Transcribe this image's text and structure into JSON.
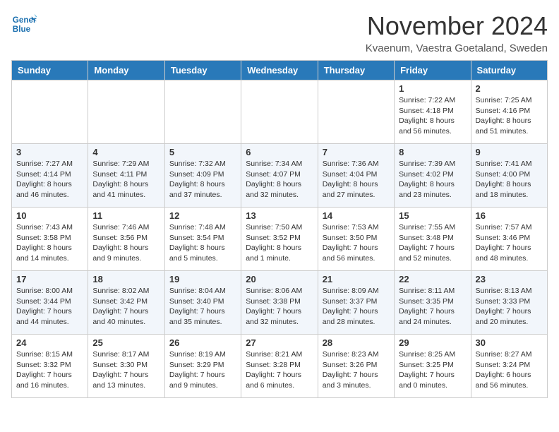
{
  "header": {
    "logo_line1": "General",
    "logo_line2": "Blue",
    "month_title": "November 2024",
    "location": "Kvaenum, Vaestra Goetaland, Sweden"
  },
  "weekdays": [
    "Sunday",
    "Monday",
    "Tuesday",
    "Wednesday",
    "Thursday",
    "Friday",
    "Saturday"
  ],
  "weeks": [
    [
      {
        "day": "",
        "info": ""
      },
      {
        "day": "",
        "info": ""
      },
      {
        "day": "",
        "info": ""
      },
      {
        "day": "",
        "info": ""
      },
      {
        "day": "",
        "info": ""
      },
      {
        "day": "1",
        "info": "Sunrise: 7:22 AM\nSunset: 4:18 PM\nDaylight: 8 hours\nand 56 minutes."
      },
      {
        "day": "2",
        "info": "Sunrise: 7:25 AM\nSunset: 4:16 PM\nDaylight: 8 hours\nand 51 minutes."
      }
    ],
    [
      {
        "day": "3",
        "info": "Sunrise: 7:27 AM\nSunset: 4:14 PM\nDaylight: 8 hours\nand 46 minutes."
      },
      {
        "day": "4",
        "info": "Sunrise: 7:29 AM\nSunset: 4:11 PM\nDaylight: 8 hours\nand 41 minutes."
      },
      {
        "day": "5",
        "info": "Sunrise: 7:32 AM\nSunset: 4:09 PM\nDaylight: 8 hours\nand 37 minutes."
      },
      {
        "day": "6",
        "info": "Sunrise: 7:34 AM\nSunset: 4:07 PM\nDaylight: 8 hours\nand 32 minutes."
      },
      {
        "day": "7",
        "info": "Sunrise: 7:36 AM\nSunset: 4:04 PM\nDaylight: 8 hours\nand 27 minutes."
      },
      {
        "day": "8",
        "info": "Sunrise: 7:39 AM\nSunset: 4:02 PM\nDaylight: 8 hours\nand 23 minutes."
      },
      {
        "day": "9",
        "info": "Sunrise: 7:41 AM\nSunset: 4:00 PM\nDaylight: 8 hours\nand 18 minutes."
      }
    ],
    [
      {
        "day": "10",
        "info": "Sunrise: 7:43 AM\nSunset: 3:58 PM\nDaylight: 8 hours\nand 14 minutes."
      },
      {
        "day": "11",
        "info": "Sunrise: 7:46 AM\nSunset: 3:56 PM\nDaylight: 8 hours\nand 9 minutes."
      },
      {
        "day": "12",
        "info": "Sunrise: 7:48 AM\nSunset: 3:54 PM\nDaylight: 8 hours\nand 5 minutes."
      },
      {
        "day": "13",
        "info": "Sunrise: 7:50 AM\nSunset: 3:52 PM\nDaylight: 8 hours\nand 1 minute."
      },
      {
        "day": "14",
        "info": "Sunrise: 7:53 AM\nSunset: 3:50 PM\nDaylight: 7 hours\nand 56 minutes."
      },
      {
        "day": "15",
        "info": "Sunrise: 7:55 AM\nSunset: 3:48 PM\nDaylight: 7 hours\nand 52 minutes."
      },
      {
        "day": "16",
        "info": "Sunrise: 7:57 AM\nSunset: 3:46 PM\nDaylight: 7 hours\nand 48 minutes."
      }
    ],
    [
      {
        "day": "17",
        "info": "Sunrise: 8:00 AM\nSunset: 3:44 PM\nDaylight: 7 hours\nand 44 minutes."
      },
      {
        "day": "18",
        "info": "Sunrise: 8:02 AM\nSunset: 3:42 PM\nDaylight: 7 hours\nand 40 minutes."
      },
      {
        "day": "19",
        "info": "Sunrise: 8:04 AM\nSunset: 3:40 PM\nDaylight: 7 hours\nand 35 minutes."
      },
      {
        "day": "20",
        "info": "Sunrise: 8:06 AM\nSunset: 3:38 PM\nDaylight: 7 hours\nand 32 minutes."
      },
      {
        "day": "21",
        "info": "Sunrise: 8:09 AM\nSunset: 3:37 PM\nDaylight: 7 hours\nand 28 minutes."
      },
      {
        "day": "22",
        "info": "Sunrise: 8:11 AM\nSunset: 3:35 PM\nDaylight: 7 hours\nand 24 minutes."
      },
      {
        "day": "23",
        "info": "Sunrise: 8:13 AM\nSunset: 3:33 PM\nDaylight: 7 hours\nand 20 minutes."
      }
    ],
    [
      {
        "day": "24",
        "info": "Sunrise: 8:15 AM\nSunset: 3:32 PM\nDaylight: 7 hours\nand 16 minutes."
      },
      {
        "day": "25",
        "info": "Sunrise: 8:17 AM\nSunset: 3:30 PM\nDaylight: 7 hours\nand 13 minutes."
      },
      {
        "day": "26",
        "info": "Sunrise: 8:19 AM\nSunset: 3:29 PM\nDaylight: 7 hours\nand 9 minutes."
      },
      {
        "day": "27",
        "info": "Sunrise: 8:21 AM\nSunset: 3:28 PM\nDaylight: 7 hours\nand 6 minutes."
      },
      {
        "day": "28",
        "info": "Sunrise: 8:23 AM\nSunset: 3:26 PM\nDaylight: 7 hours\nand 3 minutes."
      },
      {
        "day": "29",
        "info": "Sunrise: 8:25 AM\nSunset: 3:25 PM\nDaylight: 7 hours\nand 0 minutes."
      },
      {
        "day": "30",
        "info": "Sunrise: 8:27 AM\nSunset: 3:24 PM\nDaylight: 6 hours\nand 56 minutes."
      }
    ]
  ]
}
